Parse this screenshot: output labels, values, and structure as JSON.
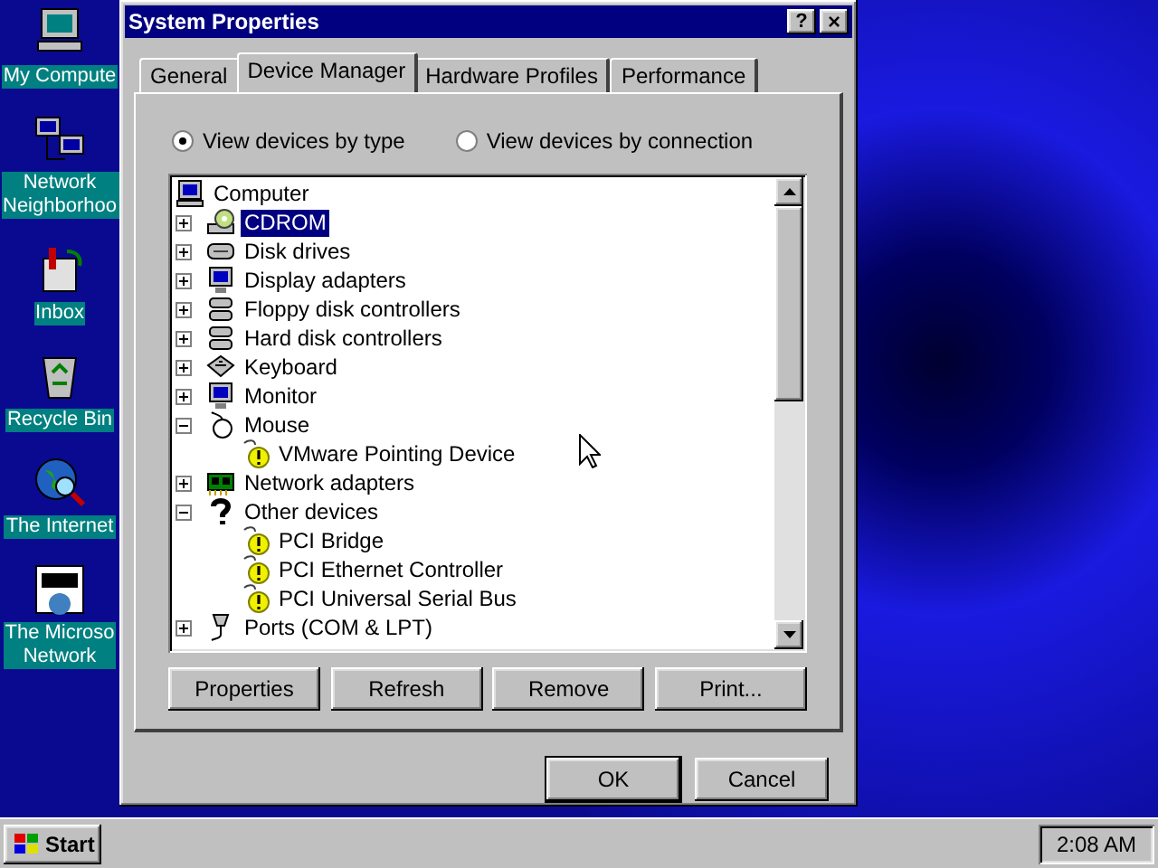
{
  "desktop_icons": [
    {
      "kind": "computer",
      "lines": [
        "My Compute"
      ]
    },
    {
      "kind": "network",
      "lines": [
        "Network",
        "Neighborhoo"
      ]
    },
    {
      "kind": "inbox",
      "lines": [
        "Inbox"
      ]
    },
    {
      "kind": "recycle",
      "lines": [
        "Recycle Bin"
      ]
    },
    {
      "kind": "internet",
      "lines": [
        "The Internet"
      ]
    },
    {
      "kind": "msn",
      "lines": [
        "The Microso",
        "Network"
      ]
    }
  ],
  "window": {
    "title": "System Properties",
    "help": "?",
    "close": "×"
  },
  "tabs": [
    {
      "label": "General",
      "selected": false
    },
    {
      "label": "Device Manager",
      "selected": true
    },
    {
      "label": "Hardware Profiles",
      "selected": false
    },
    {
      "label": "Performance",
      "selected": false
    }
  ],
  "view_options": [
    {
      "label": "View devices by type",
      "selected": true
    },
    {
      "label": "View devices by connection",
      "selected": false
    }
  ],
  "tree": {
    "label": "Computer",
    "kind": "computer",
    "children": [
      {
        "label": "CDROM",
        "kind": "cdrom",
        "expanded": false,
        "selected": true
      },
      {
        "label": "Disk drives",
        "kind": "disk",
        "expanded": false,
        "selected": false
      },
      {
        "label": "Display adapters",
        "kind": "monitor",
        "expanded": false,
        "selected": false
      },
      {
        "label": "Floppy disk controllers",
        "kind": "controller",
        "expanded": false,
        "selected": false
      },
      {
        "label": "Hard disk controllers",
        "kind": "controller",
        "expanded": false,
        "selected": false
      },
      {
        "label": "Keyboard",
        "kind": "keyboard",
        "expanded": false,
        "selected": false
      },
      {
        "label": "Monitor",
        "kind": "monitor",
        "expanded": false,
        "selected": false
      },
      {
        "label": "Mouse",
        "kind": "mouse",
        "expanded": true,
        "selected": false,
        "children": [
          {
            "label": "VMware Pointing Device",
            "kind": "warning",
            "selected": false
          }
        ]
      },
      {
        "label": "Network adapters",
        "kind": "netcard",
        "expanded": false,
        "selected": false
      },
      {
        "label": "Other devices",
        "kind": "question",
        "expanded": true,
        "selected": false,
        "children": [
          {
            "label": "PCI Bridge",
            "kind": "warning",
            "selected": false
          },
          {
            "label": "PCI Ethernet Controller",
            "kind": "warning",
            "selected": false
          },
          {
            "label": "PCI Universal Serial Bus",
            "kind": "warning",
            "selected": false
          }
        ]
      },
      {
        "label": "Ports (COM & LPT)",
        "kind": "port",
        "expanded": false,
        "selected": false
      }
    ]
  },
  "actions": [
    {
      "label": "Properties"
    },
    {
      "label": "Refresh"
    },
    {
      "label": "Remove"
    },
    {
      "label": "Print..."
    }
  ],
  "dialog_buttons": [
    {
      "label": "OK",
      "default": true
    },
    {
      "label": "Cancel",
      "default": false
    }
  ],
  "taskbar": {
    "start": "Start",
    "clock": "2:08 AM"
  }
}
